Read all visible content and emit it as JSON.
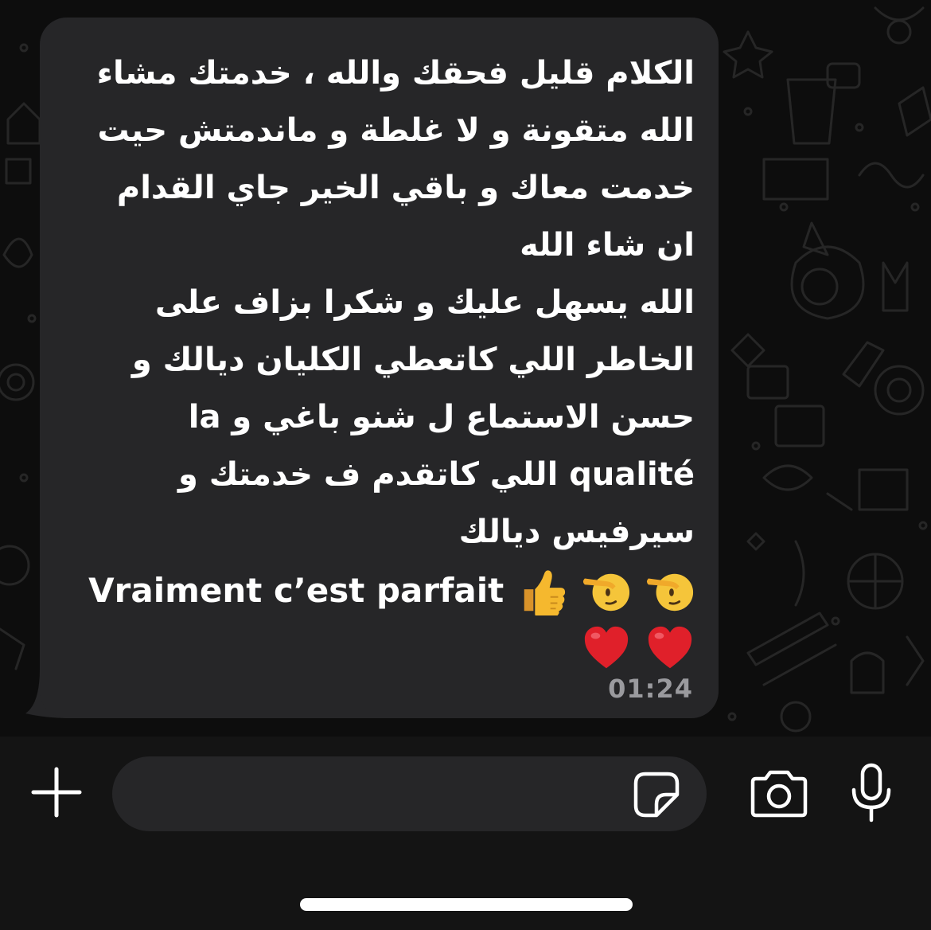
{
  "message": {
    "lines": [
      "الكلام قليل فحقك والله ، خدمتك مشاء",
      "الله متقونة و لا غلطة و ماندمتش حيت",
      "خدمت معاك و باقي الخير جاي القدام",
      "ان شاء الله",
      "الله يسهل عليك و شكرا بزاف على",
      "الخاطر اللي كاتعطي الكليان ديالك و",
      "حسن الاستماع ل شنو باغي و la",
      "qualité اللي كاتقدم ف خدمتك و",
      "سيرفيس ديالك"
    ],
    "french_line": "Vraiment c’est parfait",
    "emojis": [
      "thumbs-up",
      "saluting-face",
      "saluting-face",
      "red-heart",
      "red-heart"
    ],
    "timestamp": "01:24"
  },
  "composer": {
    "input_value": "",
    "icons": [
      "plus-icon",
      "sticker-icon",
      "camera-icon",
      "microphone-icon"
    ]
  },
  "colors": {
    "bubble": "#262628",
    "background": "#0d0d0d",
    "timestamp": "#9a9a9e",
    "heart": "#e0202a",
    "thumbs": "#f5b82e"
  }
}
